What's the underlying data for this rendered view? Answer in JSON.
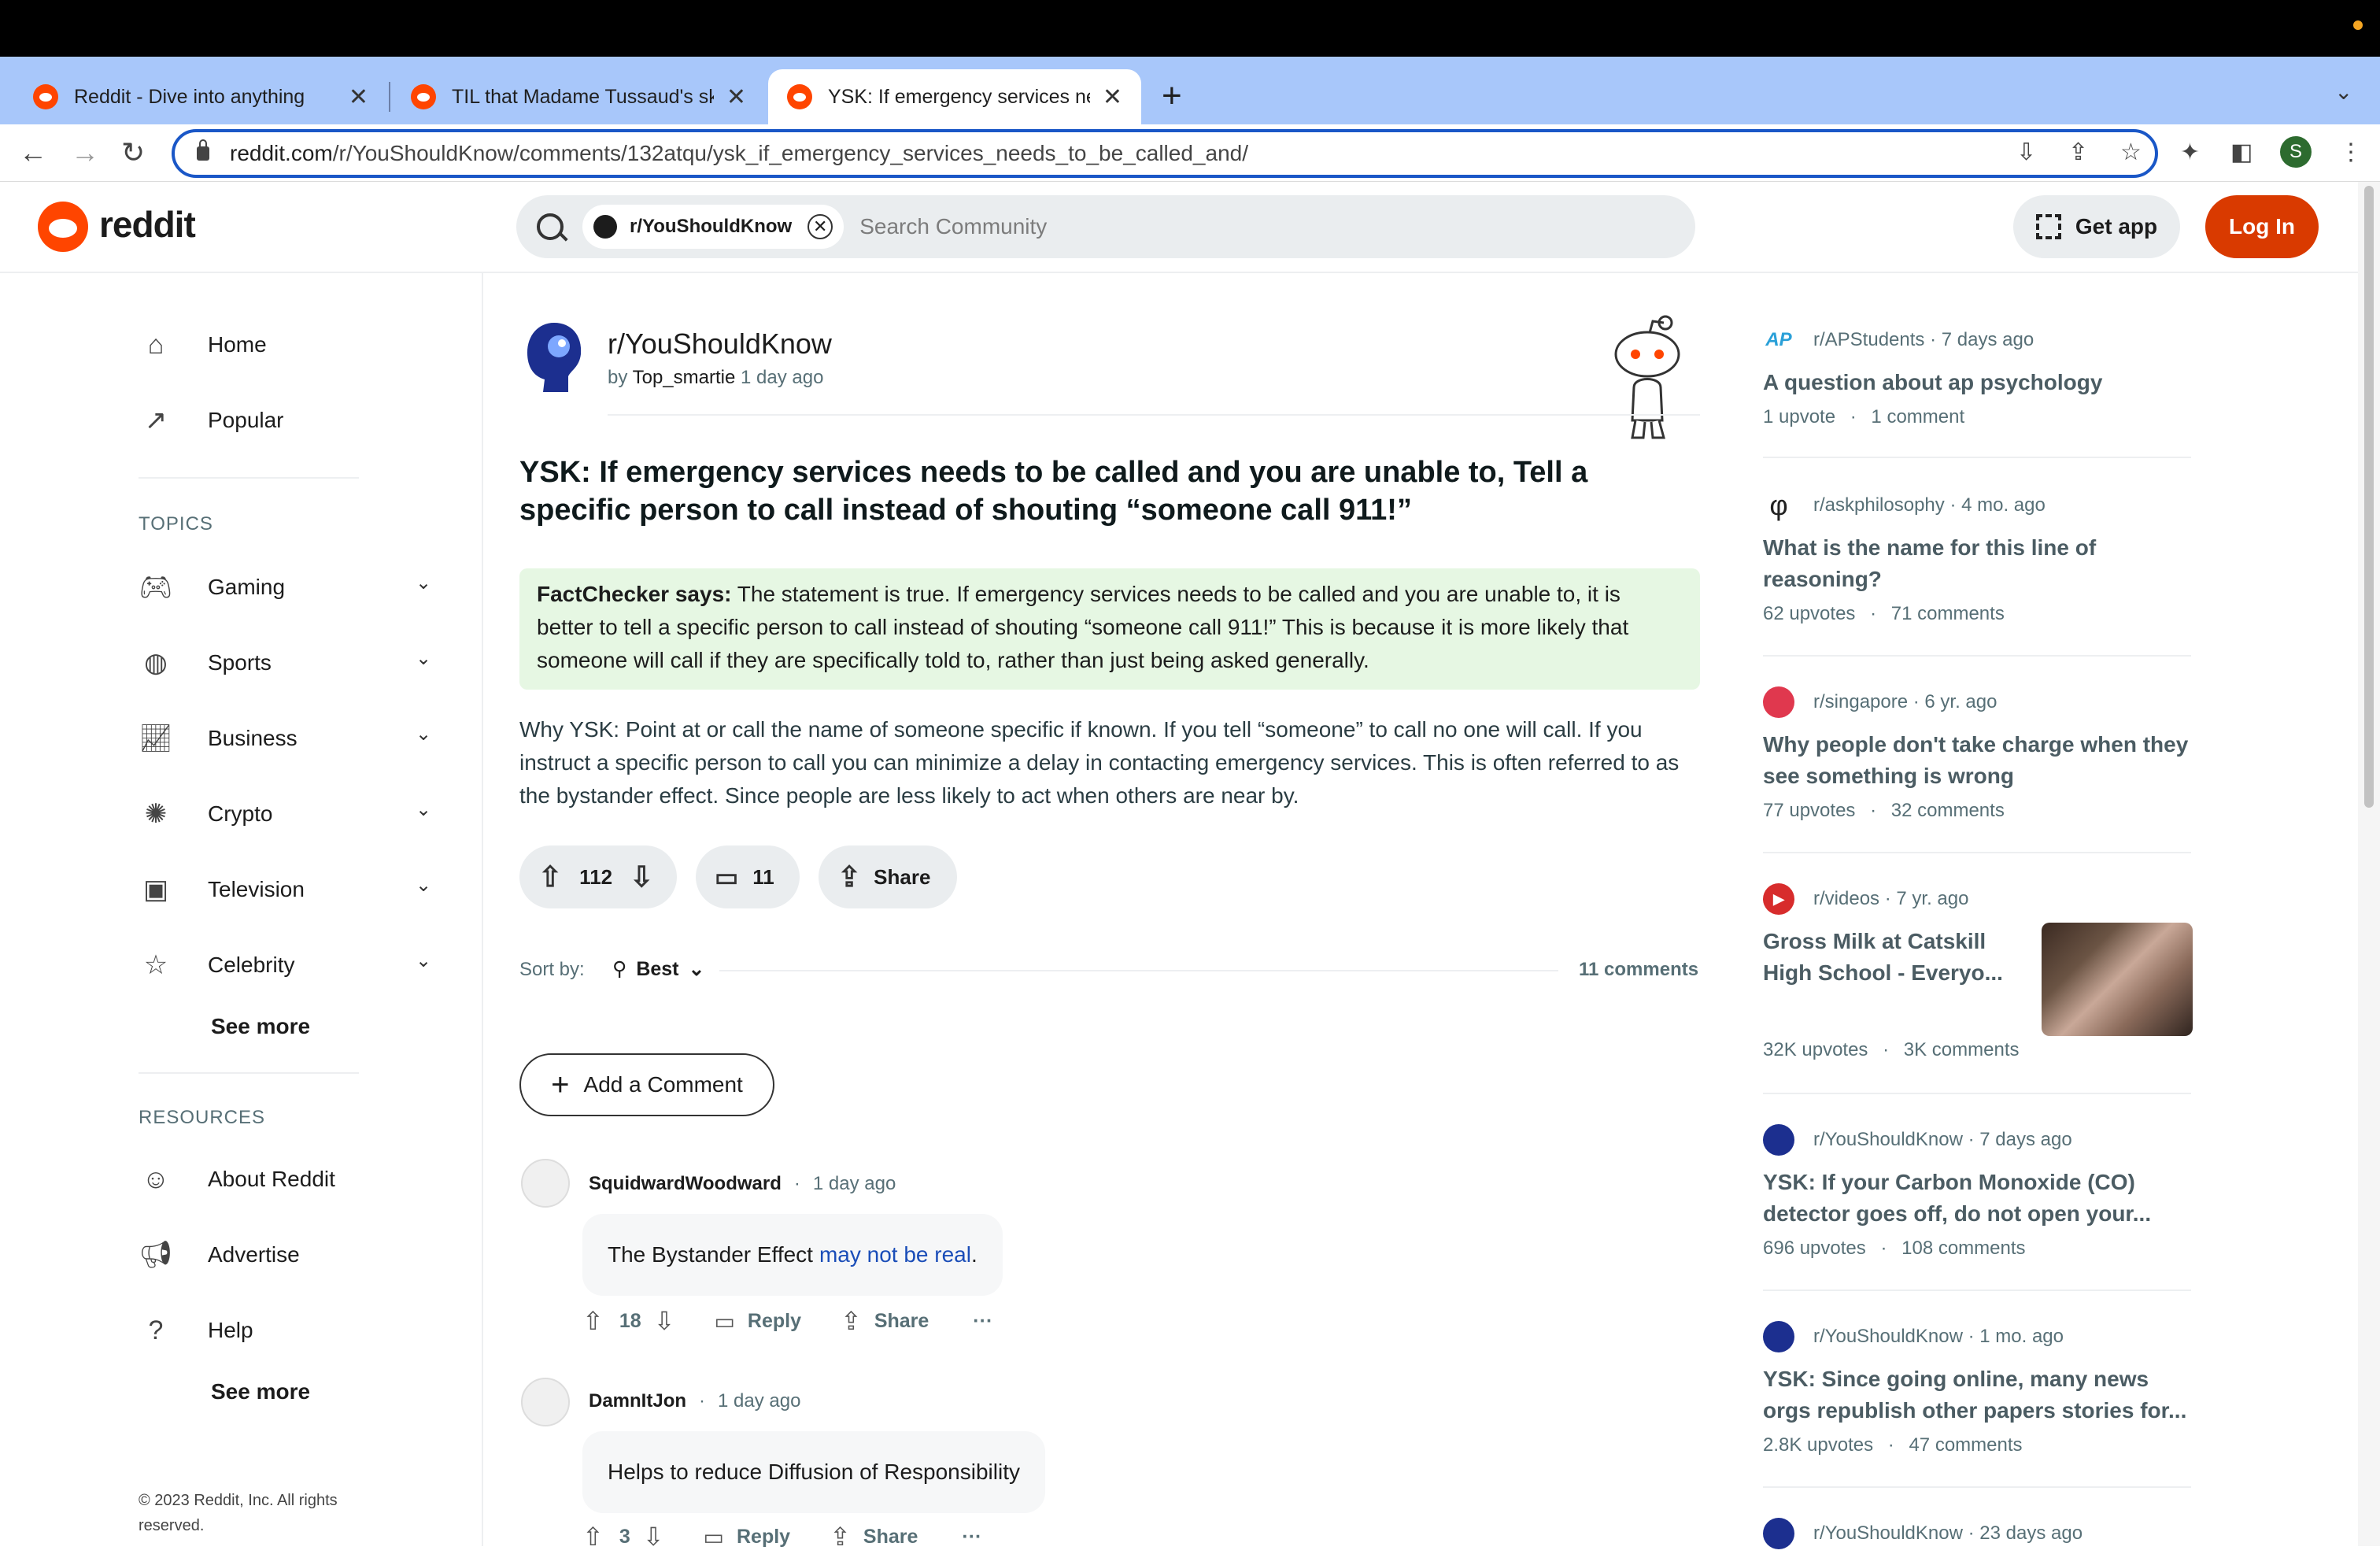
{
  "browser": {
    "tabs": [
      {
        "title": "Reddit - Dive into anything"
      },
      {
        "title": "TIL that Madame Tussaud's skills"
      },
      {
        "title": "YSK: If emergency services needs"
      }
    ],
    "url_host": "reddit.com",
    "url_path": "/r/YouShouldKnow/comments/132atqu/ysk_if_emergency_services_needs_to_be_called_and/",
    "profile_initial": "S"
  },
  "header": {
    "brand": "reddit",
    "search_chip": "r/YouShouldKnow",
    "search_placeholder": "Search Community",
    "get_app": "Get app",
    "login": "Log In"
  },
  "sidebar": {
    "main": [
      {
        "label": "Home",
        "icon": "home-icon"
      },
      {
        "label": "Popular",
        "icon": "popular-icon"
      }
    ],
    "topics_heading": "TOPICS",
    "topics": [
      {
        "label": "Gaming",
        "icon": "gaming-icon"
      },
      {
        "label": "Sports",
        "icon": "sports-icon"
      },
      {
        "label": "Business",
        "icon": "business-icon"
      },
      {
        "label": "Crypto",
        "icon": "crypto-icon"
      },
      {
        "label": "Television",
        "icon": "television-icon"
      },
      {
        "label": "Celebrity",
        "icon": "celebrity-icon"
      }
    ],
    "see_more": "See more",
    "resources_heading": "RESOURCES",
    "resources": [
      {
        "label": "About Reddit",
        "icon": "about-icon"
      },
      {
        "label": "Advertise",
        "icon": "advertise-icon"
      },
      {
        "label": "Help",
        "icon": "help-icon"
      }
    ],
    "copyright": "© 2023 Reddit, Inc. All rights reserved."
  },
  "post": {
    "subreddit": "r/YouShouldKnow",
    "by": "by",
    "author": "Top_smartie",
    "age": "1 day ago",
    "title": "YSK: If emergency services needs to be called and you are unable to, Tell a specific person to call instead of shouting “someone call 911!”",
    "factchecker_label": "FactChecker says:",
    "factchecker_text": "The statement is true. If emergency services needs to be called and you are unable to, it is better to tell a specific person to call instead of shouting “someone call 911!” This is because it is more likely that someone will call if they are specifically told to, rather than just being asked generally.",
    "body": "Why YSK: Point at or call the name of someone specific if known. If you tell “someone” to call no one will call. If you instruct a specific person to call you can minimize a delay in contacting emergency services. This is often referred to as the bystander effect. Since people are less likely to act when others are near by.",
    "votes": "112",
    "comments": "11",
    "share": "Share",
    "sort_label": "Sort by:",
    "sort_value": "Best",
    "comment_count": "11 comments",
    "add_comment": "Add a Comment"
  },
  "comments": [
    {
      "author": "SquidwardWoodward",
      "sep": "·",
      "age": "1 day ago",
      "text": "The Bystander Effect",
      "link": "may not be real",
      "after": ".",
      "votes": "18",
      "reply": "Reply",
      "share": "Share",
      "more": "···"
    },
    {
      "author": "DamnItJon",
      "sep": "·",
      "age": "1 day ago",
      "text": "Helps to reduce Diffusion of Responsibility",
      "votes": "3",
      "reply": "Reply",
      "share": "Share",
      "more": "···"
    }
  ],
  "rail": [
    {
      "sub": "r/APStudents",
      "age": "· 7 days ago",
      "title": "A question about ap psychology",
      "upvotes": "1 upvote",
      "comments": "1 comment",
      "icon": "AP"
    },
    {
      "sub": "r/askphilosophy",
      "age": "· 4 mo. ago",
      "title": "What is the name for this line of reasoning?",
      "upvotes": "62 upvotes",
      "comments": "71 comments",
      "icon": "φ"
    },
    {
      "sub": "r/singapore",
      "age": "· 6 yr. ago",
      "title": "Why people don't take charge when they see something is wrong",
      "upvotes": "77 upvotes",
      "comments": "32 comments",
      "icon": "sg"
    },
    {
      "sub": "r/videos",
      "age": "· 7 yr. ago",
      "title": "Gross Milk at Catskill High School - Everyo...",
      "upvotes": "32K upvotes",
      "comments": "3K comments",
      "icon": "▶"
    },
    {
      "sub": "r/YouShouldKnow",
      "age": "· 7 days ago",
      "title": "YSK: If your Carbon Monoxide (CO) detector goes off, do not open your...",
      "upvotes": "696 upvotes",
      "comments": "108 comments",
      "icon": "ysk"
    },
    {
      "sub": "r/YouShouldKnow",
      "age": "· 1 mo. ago",
      "title": "YSK: Since going online, many news orgs republish other papers stories for...",
      "upvotes": "2.8K upvotes",
      "comments": "47 comments",
      "icon": "ysk"
    },
    {
      "sub": "r/YouShouldKnow",
      "age": "· 23 days ago",
      "icon": "ysk"
    }
  ],
  "rail_dot": "·",
  "colors": {
    "brand": "#ff4500",
    "login": "#d93a00",
    "fact_bg": "#e6f7e3",
    "link": "#1a4db8"
  }
}
